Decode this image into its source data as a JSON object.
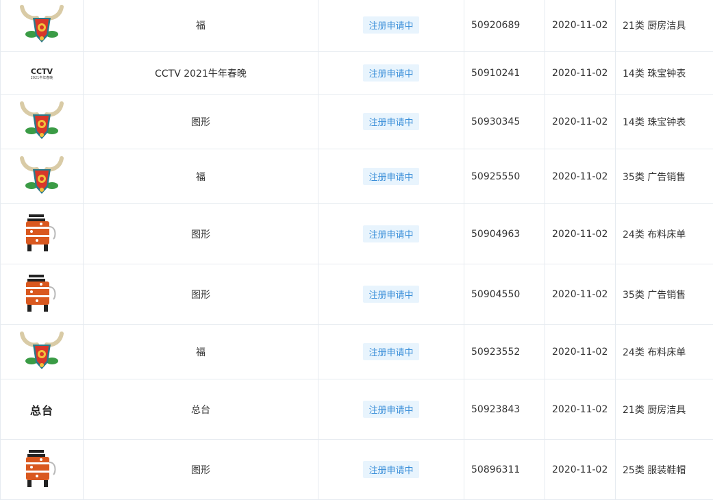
{
  "rows": [
    {
      "logo": "ox-head-logo",
      "name": "福",
      "status": "注册申请中",
      "reg_no": "50920689",
      "date": "2020-11-02",
      "class": "21类 厨房洁具",
      "row_h": 78
    },
    {
      "logo": "cctv-logo",
      "logo_text": "CCTV",
      "logo_sub": "2021牛年春晚",
      "name": "CCTV 2021牛年春晚",
      "status": "注册申请中",
      "reg_no": "50910241",
      "date": "2020-11-02",
      "class": "14类 珠宝钟表",
      "row_h": 62
    },
    {
      "logo": "ox-head-logo",
      "name": "图形",
      "status": "注册申请中",
      "reg_no": "50930345",
      "date": "2020-11-02",
      "class": "14类 珠宝钟表",
      "row_h": 80
    },
    {
      "logo": "ox-head-logo",
      "name": "福",
      "status": "注册申请中",
      "reg_no": "50925550",
      "date": "2020-11-02",
      "class": "35类 广告销售",
      "row_h": 80
    },
    {
      "logo": "ox-body-logo",
      "name": "图形",
      "status": "注册申请中",
      "reg_no": "50904963",
      "date": "2020-11-02",
      "class": "24类 布料床单",
      "row_h": 88
    },
    {
      "logo": "ox-body-logo",
      "name": "图形",
      "status": "注册申请中",
      "reg_no": "50904550",
      "date": "2020-11-02",
      "class": "35类 广告销售",
      "row_h": 88
    },
    {
      "logo": "ox-head-logo",
      "name": "福",
      "status": "注册申请中",
      "reg_no": "50923552",
      "date": "2020-11-02",
      "class": "24类 布料床单",
      "row_h": 80
    },
    {
      "logo": "text-logo",
      "logo_text": "总台",
      "name": "总台",
      "status": "注册申请中",
      "reg_no": "50923843",
      "date": "2020-11-02",
      "class": "21类 厨房洁具",
      "row_h": 88
    },
    {
      "logo": "ox-body-logo",
      "name": "图形",
      "status": "注册申请中",
      "reg_no": "50896311",
      "date": "2020-11-02",
      "class": "25类 服装鞋帽",
      "row_h": 88
    }
  ]
}
